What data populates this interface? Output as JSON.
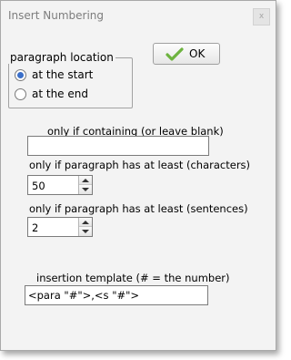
{
  "window": {
    "title": "Insert Numbering",
    "close_glyph": "x"
  },
  "location_group": {
    "legend": "paragraph location",
    "options": [
      {
        "label": "at the start",
        "checked": true
      },
      {
        "label": "at the end",
        "checked": false
      }
    ]
  },
  "ok_button": {
    "label": "OK",
    "icon": "checkmark-icon",
    "icon_color": "#6db33f"
  },
  "containing": {
    "label": "only if containing (or leave blank)",
    "value": ""
  },
  "min_chars": {
    "label": "only if paragraph has at least (characters)",
    "value": "50"
  },
  "min_sentences": {
    "label": "only if paragraph has at least (sentences)",
    "value": "2"
  },
  "template": {
    "label": "insertion template (# = the number)",
    "value": "<para \"#\">,<s \"#\">"
  },
  "colors": {
    "window_bg": "#f3f3f3",
    "radio_selected": "#3a6fc9",
    "title_text": "#7d7d7d"
  }
}
